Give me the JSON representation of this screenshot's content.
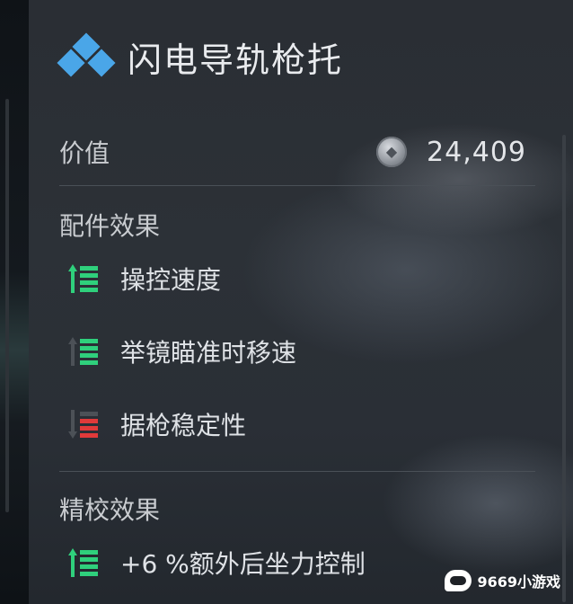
{
  "item": {
    "title": "闪电导轨枪托",
    "icon": "blue-diamond-cluster-icon",
    "value_label": "价值",
    "value_icon": "coin-icon",
    "value": "24,409"
  },
  "attachment_effects": {
    "title": "配件效果",
    "items": [
      {
        "label": "操控速度",
        "indicator": "up",
        "color": "#2fd07c"
      },
      {
        "label": "举镜瞄准时移速",
        "indicator": "up",
        "color": "#2fd07c",
        "dim_arrow": true
      },
      {
        "label": "据枪稳定性",
        "indicator": "down",
        "color": "#e03a3a"
      }
    ]
  },
  "calibration_effects": {
    "title": "精校效果",
    "items": [
      {
        "label": "+6 %额外后坐力控制",
        "indicator": "up",
        "color": "#2fd07c"
      }
    ]
  },
  "watermark": {
    "text": "9669小游戏"
  },
  "colors": {
    "accent_blue": "#4aa6e8",
    "positive_green": "#2fd07c",
    "negative_red": "#e03a3a"
  }
}
